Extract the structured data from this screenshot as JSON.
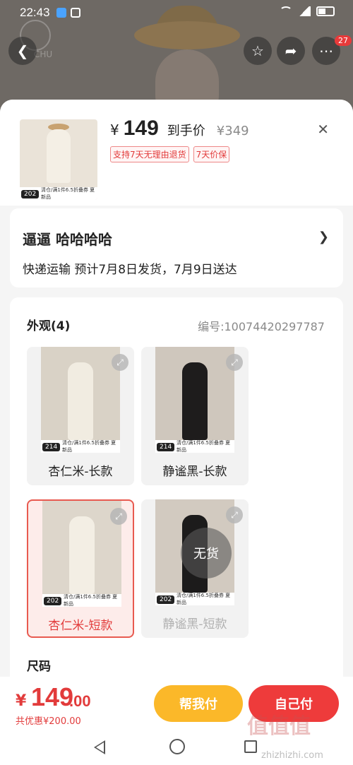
{
  "status": {
    "time": "22:43"
  },
  "backdrop": {
    "logo_text": "CHU"
  },
  "topbar": {
    "badge": "27"
  },
  "product": {
    "yen": "¥",
    "price": "149",
    "price_suffix": "到手价",
    "original_price": "¥349",
    "chips": [
      "支持7天无理由退货",
      "7天价保"
    ],
    "thumb_tag": "202",
    "thumb_strip": "清仓/满1件6.5折叠券  夏新品"
  },
  "address": {
    "name": "逼逼  哈哈哈哈",
    "shipping": "快递运输 预计7月8日发货，7月9日送达"
  },
  "options": {
    "title": "外观(4)",
    "sku": "编号:10074420297787",
    "variants": [
      {
        "label": "杏仁米-长款",
        "tag": "214",
        "state": "normal",
        "dress": "#f1ece1",
        "bg": "#d9d2c6"
      },
      {
        "label": "静谧黑-长款",
        "tag": "214",
        "state": "normal",
        "dress": "#1e1c1c",
        "bg": "#cfc7bd"
      },
      {
        "label": "杏仁米-短款",
        "tag": "202",
        "state": "selected",
        "dress": "#f3eee4",
        "bg": "#ddd6cb"
      },
      {
        "label": "静谧黑-短款",
        "tag": "202",
        "state": "soldout",
        "dress": "#1c1b1b",
        "bg": "#d2cac0"
      }
    ],
    "strip_text": "清仓/满1件6.5折叠券  夏新品",
    "soldout_text": "无货",
    "size_title": "尺码"
  },
  "bottom": {
    "yen": "¥",
    "total_int": "149",
    "total_dec": ".00",
    "discount": "共优惠¥200.00",
    "help_pay": "帮我付",
    "self_pay": "自己付"
  },
  "watermark": {
    "big": "值值值",
    "small": "zhizhizhi.com"
  }
}
